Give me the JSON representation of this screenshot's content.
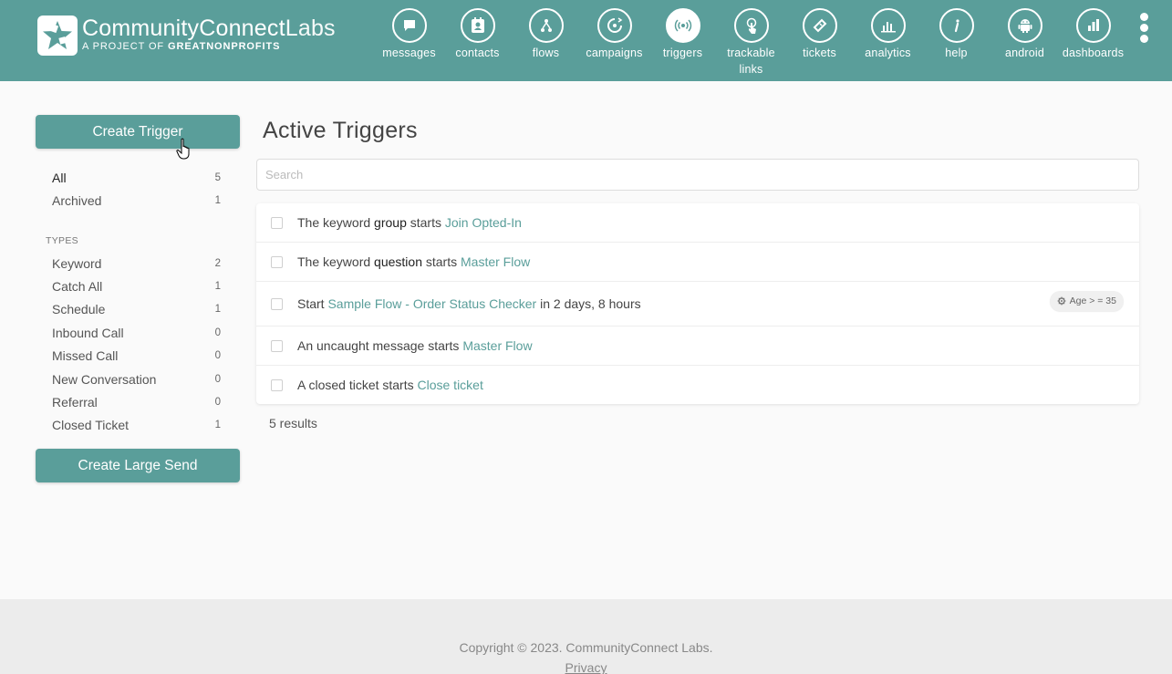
{
  "brand": {
    "name_main": "CommunityConnect",
    "name_suffix": "Labs",
    "subtitle_prefix": "A PROJECT OF ",
    "subtitle_org": "GREATNONPROFITS"
  },
  "nav": [
    {
      "label": "messages",
      "icon": "message-icon"
    },
    {
      "label": "contacts",
      "icon": "contacts-icon"
    },
    {
      "label": "flows",
      "icon": "flows-icon"
    },
    {
      "label": "campaigns",
      "icon": "campaigns-icon"
    },
    {
      "label": "triggers",
      "icon": "triggers-icon",
      "active": true
    },
    {
      "label": "trackable links",
      "icon": "trackable-links-icon"
    },
    {
      "label": "tickets",
      "icon": "tickets-icon"
    },
    {
      "label": "analytics",
      "icon": "analytics-icon"
    },
    {
      "label": "help",
      "icon": "help-icon"
    },
    {
      "label": "android",
      "icon": "android-icon"
    },
    {
      "label": "dashboards",
      "icon": "dashboards-icon"
    }
  ],
  "sidebar": {
    "create_trigger": "Create Trigger",
    "filters": [
      {
        "label": "All",
        "count": "5"
      },
      {
        "label": "Archived",
        "count": "1"
      }
    ],
    "types_heading": "TYPES",
    "types": [
      {
        "label": "Keyword",
        "count": "2"
      },
      {
        "label": "Catch All",
        "count": "1"
      },
      {
        "label": "Schedule",
        "count": "1"
      },
      {
        "label": "Inbound Call",
        "count": "0"
      },
      {
        "label": "Missed Call",
        "count": "0"
      },
      {
        "label": "New Conversation",
        "count": "0"
      },
      {
        "label": "Referral",
        "count": "0"
      },
      {
        "label": "Closed Ticket",
        "count": "1"
      }
    ],
    "create_large_send": "Create Large Send"
  },
  "main": {
    "title": "Active Triggers",
    "search_placeholder": "Search",
    "triggers": [
      {
        "pre": "The keyword ",
        "keyword": "group",
        "mid": " starts ",
        "link": "Join Opted-In",
        "post": ""
      },
      {
        "pre": "The keyword ",
        "keyword": "question",
        "mid": " starts ",
        "link": "Master Flow",
        "post": ""
      },
      {
        "pre": "Start ",
        "keyword": "",
        "mid": "",
        "link": "Sample Flow - Order Status Checker",
        "post": " in 2 days, 8 hours",
        "badge": "Age > = 35"
      },
      {
        "pre": "An uncaught message starts ",
        "keyword": "",
        "mid": "",
        "link": "Master Flow",
        "post": ""
      },
      {
        "pre": "A closed ticket starts ",
        "keyword": "",
        "mid": "",
        "link": "Close ticket",
        "post": ""
      }
    ],
    "results": "5 results"
  },
  "footer": {
    "copyright": "Copyright © 2023. CommunityConnect Labs.",
    "privacy": "Privacy"
  },
  "colors": {
    "brand": "#5a9e9a",
    "link": "#5a9e9a"
  }
}
